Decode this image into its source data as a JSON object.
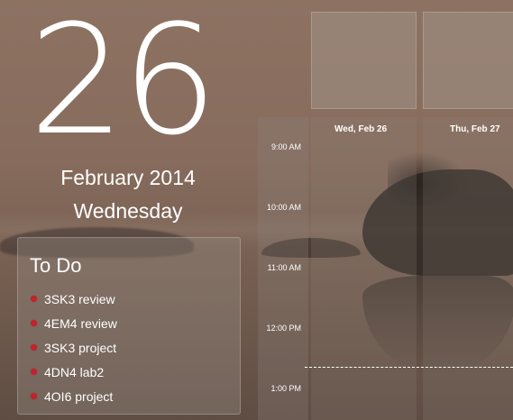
{
  "date": {
    "day": "26",
    "month_year": "February 2014",
    "weekday": "Wednesday"
  },
  "todo": {
    "title": "To Do",
    "items": [
      {
        "label": "3SK3 review"
      },
      {
        "label": "4EM4 review"
      },
      {
        "label": "3SK3 project"
      },
      {
        "label": "4DN4 lab2"
      },
      {
        "label": "4OI6 project"
      }
    ]
  },
  "calendar": {
    "days": [
      {
        "header": "Wed, Feb 26"
      },
      {
        "header": "Thu, Feb 27"
      }
    ],
    "time_labels": [
      "9:00 AM",
      "10:00 AM",
      "11:00 AM",
      "12:00 PM",
      "1:00 PM"
    ]
  },
  "colors": {
    "todo_bullet": "#c8202a",
    "text": "#ffffff"
  }
}
